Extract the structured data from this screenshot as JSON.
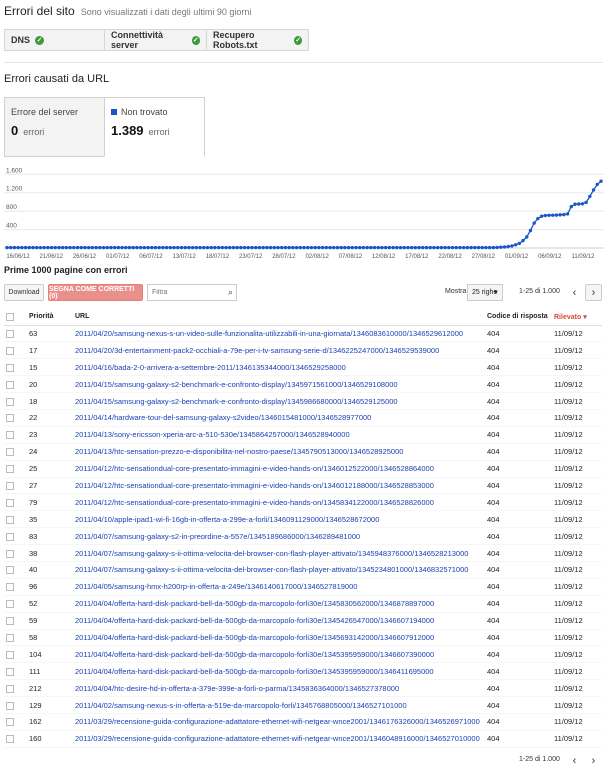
{
  "site_errors": {
    "title": "Errori del sito",
    "subtitle": "Sono visualizzati i dati degli ultimi 90 giorni",
    "tabs": [
      {
        "label": "DNS"
      },
      {
        "label": "Connettività server"
      },
      {
        "label": "Recupero Robots.txt"
      }
    ]
  },
  "url_errors": {
    "title": "Errori causati da URL",
    "categories": [
      {
        "name": "Errore del server",
        "value": "0",
        "unit": "errori"
      },
      {
        "name": "Non trovato",
        "value": "1.389",
        "unit": "errori"
      }
    ]
  },
  "colors": {
    "accent": "#1a56c7",
    "link": "#1a3fb5",
    "mark_red": "#e9908a",
    "check_green": "#3b9a3b"
  },
  "chart_data": {
    "type": "line",
    "series": [
      {
        "values": [
          9,
          9,
          9,
          9,
          9,
          9,
          9,
          9,
          9,
          9,
          9,
          9,
          9,
          9,
          9,
          9,
          9,
          9,
          9,
          9,
          9,
          9,
          9,
          9,
          9,
          9,
          9,
          9,
          9,
          9,
          9,
          9,
          9,
          9,
          9,
          9,
          9,
          9,
          9,
          9,
          9,
          9,
          9,
          9,
          9,
          9,
          9,
          9,
          9,
          9,
          9,
          9,
          9,
          9,
          9,
          9,
          9,
          9,
          9,
          9,
          9,
          9,
          9,
          9,
          9,
          9,
          9,
          9,
          9,
          9,
          9,
          9,
          9,
          9,
          9,
          9,
          9,
          9,
          9,
          9,
          9,
          9,
          9,
          9,
          9,
          9,
          9,
          9,
          9,
          9,
          9,
          9,
          9,
          9,
          9,
          9,
          9,
          9,
          9,
          9,
          9,
          9,
          9,
          9,
          9,
          9,
          9,
          9,
          9,
          9,
          9,
          9,
          9,
          9,
          9,
          9,
          9,
          9,
          9,
          9,
          9,
          9,
          9,
          9,
          9,
          9,
          9,
          9,
          9,
          9,
          9,
          9,
          12,
          17,
          22,
          30,
          45,
          70,
          100,
          160,
          240,
          380,
          540,
          640,
          690,
          705,
          710,
          712,
          715,
          720,
          725,
          740,
          900,
          950,
          955,
          960,
          990,
          1120,
          1260,
          1380,
          1450
        ],
        "color": "#1a56c7"
      }
    ],
    "y_ticks": [
      "400",
      "800",
      "1.200",
      "1.600"
    ],
    "x_ticks": [
      "16/06/12",
      "21/06/12",
      "26/06/12",
      "01/07/12",
      "06/07/12",
      "13/07/12",
      "18/07/12",
      "23/07/12",
      "28/07/12",
      "02/08/12",
      "07/08/12",
      "12/08/12",
      "17/08/12",
      "22/08/12",
      "27/08/12",
      "01/09/12",
      "06/09/12",
      "11/09/12"
    ],
    "ylim": [
      0,
      1650
    ],
    "grid": true
  },
  "table_section": {
    "title": "Prime 1000 pagine con errori",
    "download_label": "Download",
    "mark_fixed_label": "SEGNA COME CORRETTI (0)",
    "filter_placeholder": "Filtra",
    "show_label": "Mostra",
    "rows_select": "25 righe",
    "range": "1-25 di 1.000",
    "columns": {
      "priority": "Priorità",
      "url": "URL",
      "code": "Codice di risposta",
      "detected": "Rilevato"
    }
  },
  "rows": [
    {
      "priority": "63",
      "url": "2011/04/20/samsung-nexus-s-un-video-sulle-funzionalita-utilizzabili-in-una-giornata/1346083610000/1346529612000",
      "code": "404",
      "date": "11/09/12"
    },
    {
      "priority": "17",
      "url": "2011/04/20/3d-entertainment-pack2-occhiali-a-79e-per-i-tv-samsung-serie-d/1346225247000/1346529539000",
      "code": "404",
      "date": "11/09/12"
    },
    {
      "priority": "15",
      "url": "2011/04/16/bada-2-0-arrivera-a-settembre-2011/1346135344000/1346529258000",
      "code": "404",
      "date": "11/09/12"
    },
    {
      "priority": "20",
      "url": "2011/04/15/samsung-galaxy-s2-benchmark-e-confronto-display/1345971561000/1346529108000",
      "code": "404",
      "date": "11/09/12"
    },
    {
      "priority": "18",
      "url": "2011/04/15/samsung-galaxy-s2-benchmark-e-confronto-display/1345986680000/1346529125000",
      "code": "404",
      "date": "11/09/12"
    },
    {
      "priority": "22",
      "url": "2011/04/14/hardware-tour-del-samsung-galaxy-s2video/1346015481000/1346528977000",
      "code": "404",
      "date": "11/09/12"
    },
    {
      "priority": "23",
      "url": "2011/04/13/sony-ericsson-xperia-arc-a-510-530e/1345864257000/1346528940000",
      "code": "404",
      "date": "11/09/12"
    },
    {
      "priority": "24",
      "url": "2011/04/13/htc-sensation-prezzo-e-disponibilita-nel-nostro-paese/1345790513000/1346528925000",
      "code": "404",
      "date": "11/09/12"
    },
    {
      "priority": "25",
      "url": "2011/04/12/htc-sensationdual-core-presentato-immagini-e-video-hands-on/1346012522000/1346528864000",
      "code": "404",
      "date": "11/09/12"
    },
    {
      "priority": "27",
      "url": "2011/04/12/htc-sensationdual-core-presentato-immagini-e-video-hands-on/1346012188000/1346528853000",
      "code": "404",
      "date": "11/09/12"
    },
    {
      "priority": "79",
      "url": "2011/04/12/htc-sensationdual-core-presentato-immagini-e-video-hands-on/1345834122000/1346528826000",
      "code": "404",
      "date": "11/09/12"
    },
    {
      "priority": "35",
      "url": "2011/04/10/apple-ipad1-wi-fi-16gb-in-offerta-a-299e-a-forli/1346091129000/1346528672000",
      "code": "404",
      "date": "11/09/12"
    },
    {
      "priority": "83",
      "url": "2011/04/07/samsung-galaxy-s2-in-preordine-a-557e/1345189686000/1346289481000",
      "code": "404",
      "date": "11/09/12"
    },
    {
      "priority": "38",
      "url": "2011/04/07/samsung-galaxy-s-ii-ottima-velocita-del-browser-con-flash-player-attivato/1345948376000/1346528213000",
      "code": "404",
      "date": "11/09/12"
    },
    {
      "priority": "40",
      "url": "2011/04/07/samsung-galaxy-s-ii-ottima-velocita-del-browser-con-flash-player-attivato/1345234801000/1346832571000",
      "code": "404",
      "date": "11/09/12"
    },
    {
      "priority": "96",
      "url": "2011/04/05/samsung-hmx-h200rp-in-offerta-a-249e/1346140617000/1346527819000",
      "code": "404",
      "date": "11/09/12"
    },
    {
      "priority": "52",
      "url": "2011/04/04/offerta-hard-disk-packard-bell-da-500gb-da-marcopolo-forli30e/1345830562000/1346878897000",
      "code": "404",
      "date": "11/09/12"
    },
    {
      "priority": "59",
      "url": "2011/04/04/offerta-hard-disk-packard-bell-da-500gb-da-marcopolo-forli30e/1345426547000/1346607194000",
      "code": "404",
      "date": "11/09/12"
    },
    {
      "priority": "58",
      "url": "2011/04/04/offerta-hard-disk-packard-bell-da-500gb-da-marcopolo-forli30e/1345693142000/1346607912000",
      "code": "404",
      "date": "11/09/12"
    },
    {
      "priority": "104",
      "url": "2011/04/04/offerta-hard-disk-packard-bell-da-500gb-da-marcopolo-forli30e/1345395959000/1346607390000",
      "code": "404",
      "date": "11/09/12"
    },
    {
      "priority": "111",
      "url": "2011/04/04/offerta-hard-disk-packard-bell-da-500gb-da-marcopolo-forli30e/1345395959000/1346411695000",
      "code": "404",
      "date": "11/09/12"
    },
    {
      "priority": "212",
      "url": "2011/04/04/htc-desire-hd-in-offerta-a-379e-399e-a-forli-o-parma/1345836364000/1346527378000",
      "code": "404",
      "date": "11/09/12"
    },
    {
      "priority": "129",
      "url": "2011/04/02/samsung-nexus-s-in-offerta-a-519e-da-marcopolo-forli/1345768805000/1346527101000",
      "code": "404",
      "date": "11/09/12"
    },
    {
      "priority": "162",
      "url": "2011/03/29/recensione-guida-configurazione-adattatore-ethernet-wifi-netgear-wnce2001/1346176326000/1346526971000",
      "code": "404",
      "date": "11/09/12"
    },
    {
      "priority": "160",
      "url": "2011/03/29/recensione-guida-configurazione-adattatore-ethernet-wifi-netgear-wnce2001/1346048916000/1346527010000",
      "code": "404",
      "date": "11/09/12"
    }
  ]
}
